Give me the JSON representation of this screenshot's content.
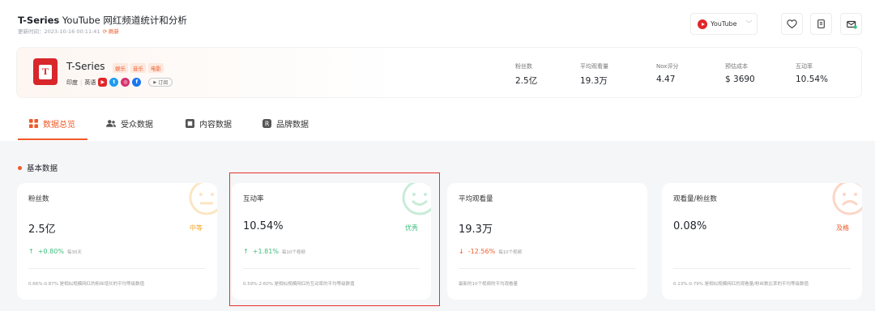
{
  "header": {
    "title_bold": "T-Series",
    "title_rest": " YouTube 网红频道统计和分析",
    "updated_label": "更新时间：",
    "updated_time": "2023-10-16 00:11:41",
    "refresh_label": "⟳ 刷新",
    "platform": "YouTube"
  },
  "profile": {
    "name": "T-Series",
    "tags": [
      "娱乐",
      "音乐",
      "电影"
    ],
    "country": "印度",
    "language": "英语",
    "subscribe_label": "订阅",
    "stats": [
      {
        "label": "粉丝数",
        "value": "2.5亿"
      },
      {
        "label": "平均观看量",
        "value": "19.3万"
      },
      {
        "label": "Nox评分",
        "value": "4.47"
      },
      {
        "label": "预估成本",
        "value": "$ 3690"
      },
      {
        "label": "互动率",
        "value": "10.54%"
      }
    ]
  },
  "tabs": [
    "数据总览",
    "受众数据",
    "内容数据",
    "品牌数据"
  ],
  "section": {
    "title": "基本数据",
    "cards": [
      {
        "label": "粉丝数",
        "value": "2.5亿",
        "rating": "中等",
        "rating_color": "#f5a623",
        "arrow": "↑",
        "change": "+0.80%",
        "change_color": "#3dbd7d",
        "note": "每30天",
        "foot": "0.66%-0.87% 是相似规模网红的粉丝增长的平均等级数值"
      },
      {
        "label": "互动率",
        "value": "10.54%",
        "rating": "优秀",
        "rating_color": "#3dbd7d",
        "arrow": "↑",
        "change": "+1.81%",
        "change_color": "#3dbd7d",
        "note": "每10个视频",
        "foot": "0.59%-2.60% 是相似规模网红的互动率的平均等级数值"
      },
      {
        "label": "平均观看量",
        "value": "19.3万",
        "rating": "",
        "rating_color": "#333333",
        "arrow": "↓",
        "change": "-12.56%",
        "change_color": "#f05a28",
        "note": "每10个视频",
        "foot": "最新的10个视频的平均观看量"
      },
      {
        "label": "观看量/粉丝数",
        "value": "0.08%",
        "rating": "及格",
        "rating_color": "#f05a28",
        "arrow": "",
        "change": "",
        "change_color": "#333333",
        "note": "",
        "foot": "0.13%-0.79% 是相似规模网红的观看量/粉丝数比率的平均等级数值"
      }
    ]
  },
  "colors": {
    "accent": "#f05a28",
    "good": "#3dbd7d",
    "medium": "#f5a623",
    "highlight": "#e5322d"
  },
  "icons": [
    "youtube-icon",
    "heart-icon",
    "document-icon",
    "mail-icon",
    "grid-icon",
    "users-icon",
    "content-icon",
    "brand-icon",
    "facebook-icon",
    "instagram-icon",
    "twitter-icon"
  ]
}
